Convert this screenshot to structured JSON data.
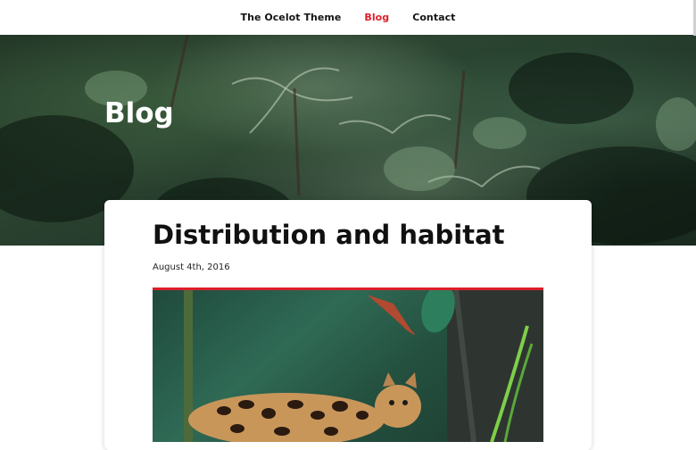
{
  "nav": {
    "items": [
      {
        "label": "The Ocelot Theme",
        "active": false
      },
      {
        "label": "Blog",
        "active": true
      },
      {
        "label": "Contact",
        "active": false
      }
    ]
  },
  "hero": {
    "title": "Blog"
  },
  "post": {
    "title": "Distribution and habitat",
    "date": "August 4th, 2016"
  },
  "colors": {
    "accent": "#dc1f2a",
    "nav_text": "#151515"
  }
}
